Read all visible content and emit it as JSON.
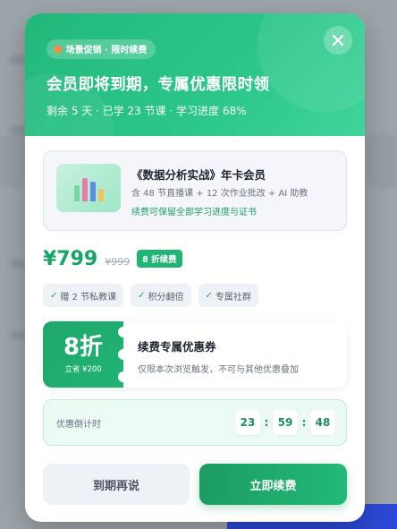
{
  "header": {
    "tag": "场景促销 · 限时续费",
    "title": "会员即将到期，专属优惠限时领",
    "subtitle": "剩余 5 天 · 已学 23 节课 · 学习进度 68%"
  },
  "product": {
    "title": "《数据分析实战》年卡会员",
    "desc": "含 48 节直播课 + 12 次作业批改 + AI 助教",
    "note": "续费可保留全部学习进度与证书"
  },
  "pricing": {
    "price": "¥799",
    "original": "¥999",
    "discount_badge": "8 折续费"
  },
  "perks": [
    "赠 2 节私教课",
    "积分翻倍",
    "专属社群"
  ],
  "coupon": {
    "big": "8折",
    "save": "立省 ¥200",
    "title": "续费专属优惠券",
    "desc": "仅限本次浏览触发，不可与其他优惠叠加"
  },
  "countdown": {
    "label": "优惠倒计时",
    "hours": "23",
    "minutes": "59",
    "seconds": "48"
  },
  "buttons": {
    "later": "到期再说",
    "renew": "立即续费"
  },
  "colors": {
    "brand_green": "#22b87a",
    "accent_green": "#17a565"
  }
}
